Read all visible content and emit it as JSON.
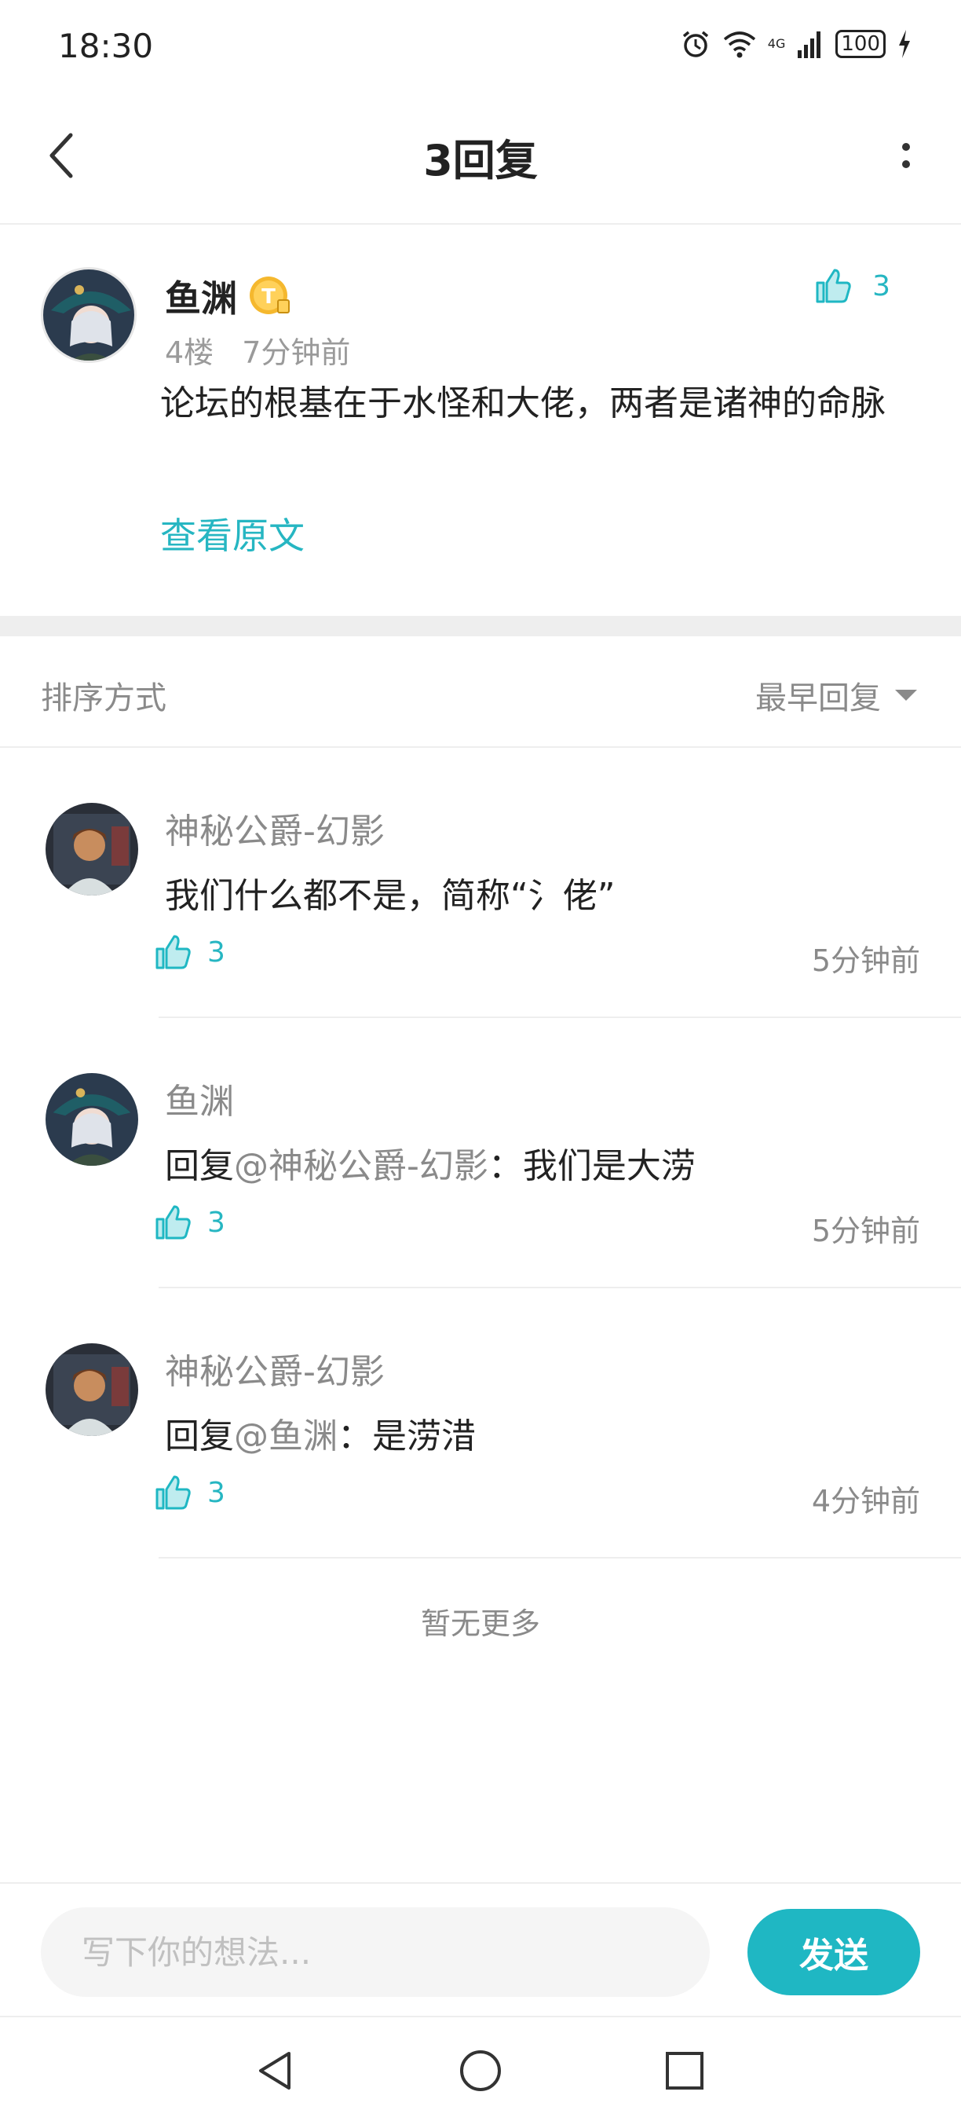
{
  "status_bar": {
    "time": "18:30",
    "network": "4G",
    "battery": "100"
  },
  "header": {
    "title": "3回复"
  },
  "main_post": {
    "author": "鱼渊",
    "badge": "T",
    "likes": "3",
    "floor": "4楼",
    "time": "7分钟前",
    "content": "论坛的根基在于水怪和大佬，两者是诸神的命脉",
    "view_original": "查看原文"
  },
  "sort": {
    "label": "排序方式",
    "value": "最早回复"
  },
  "replies": [
    {
      "author": "神秘公爵-幻影",
      "prefix": "",
      "mention": "",
      "text": "我们什么都不是，简称“氵佬”",
      "likes": "3",
      "time": "5分钟前"
    },
    {
      "author": "鱼渊",
      "prefix": "回复",
      "mention": "@神秘公爵-幻影",
      "text": "：我们是大涝",
      "likes": "3",
      "time": "5分钟前"
    },
    {
      "author": "神秘公爵-幻影",
      "prefix": "回复",
      "mention": "@鱼渊",
      "text": "：是涝㳻",
      "likes": "3",
      "time": "4分钟前"
    }
  ],
  "footer_note": "暂无更多",
  "input": {
    "placeholder": "写下你的想法...",
    "send_label": "发送"
  },
  "colors": {
    "accent": "#1fb7c3",
    "secondary_text": "#8a8a8a",
    "divider": "#eeeeee"
  },
  "icons": [
    "alarm-icon",
    "wifi-icon",
    "signal-icon",
    "battery-icon",
    "charging-icon",
    "back-icon",
    "more-icon",
    "thumbs-up-icon",
    "caret-down-icon",
    "nav-back-icon",
    "nav-home-icon",
    "nav-recents-icon"
  ]
}
